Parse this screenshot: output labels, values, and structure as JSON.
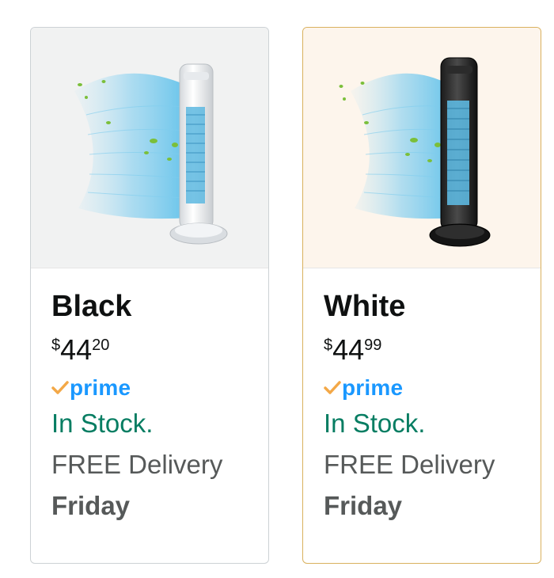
{
  "products": [
    {
      "color_name": "Black",
      "price": {
        "symbol": "$",
        "whole": "44",
        "fraction": "20"
      },
      "prime_label": "prime",
      "stock": "In Stock.",
      "delivery": "FREE Delivery",
      "delivery_day": "Friday",
      "product_image": "white-tower-fan-image",
      "selected": false
    },
    {
      "color_name": "White",
      "price": {
        "symbol": "$",
        "whole": "44",
        "fraction": "99"
      },
      "prime_label": "prime",
      "stock": "In Stock.",
      "delivery": "FREE Delivery",
      "delivery_day": "Friday",
      "product_image": "black-tower-fan-image",
      "selected": true
    }
  ],
  "colors": {
    "stock_green": "#067d62",
    "prime_blue": "#1a98ff",
    "check_orange": "#f3a847",
    "selected_border": "#d9b15e",
    "selected_bg": "#fdf5ec"
  }
}
